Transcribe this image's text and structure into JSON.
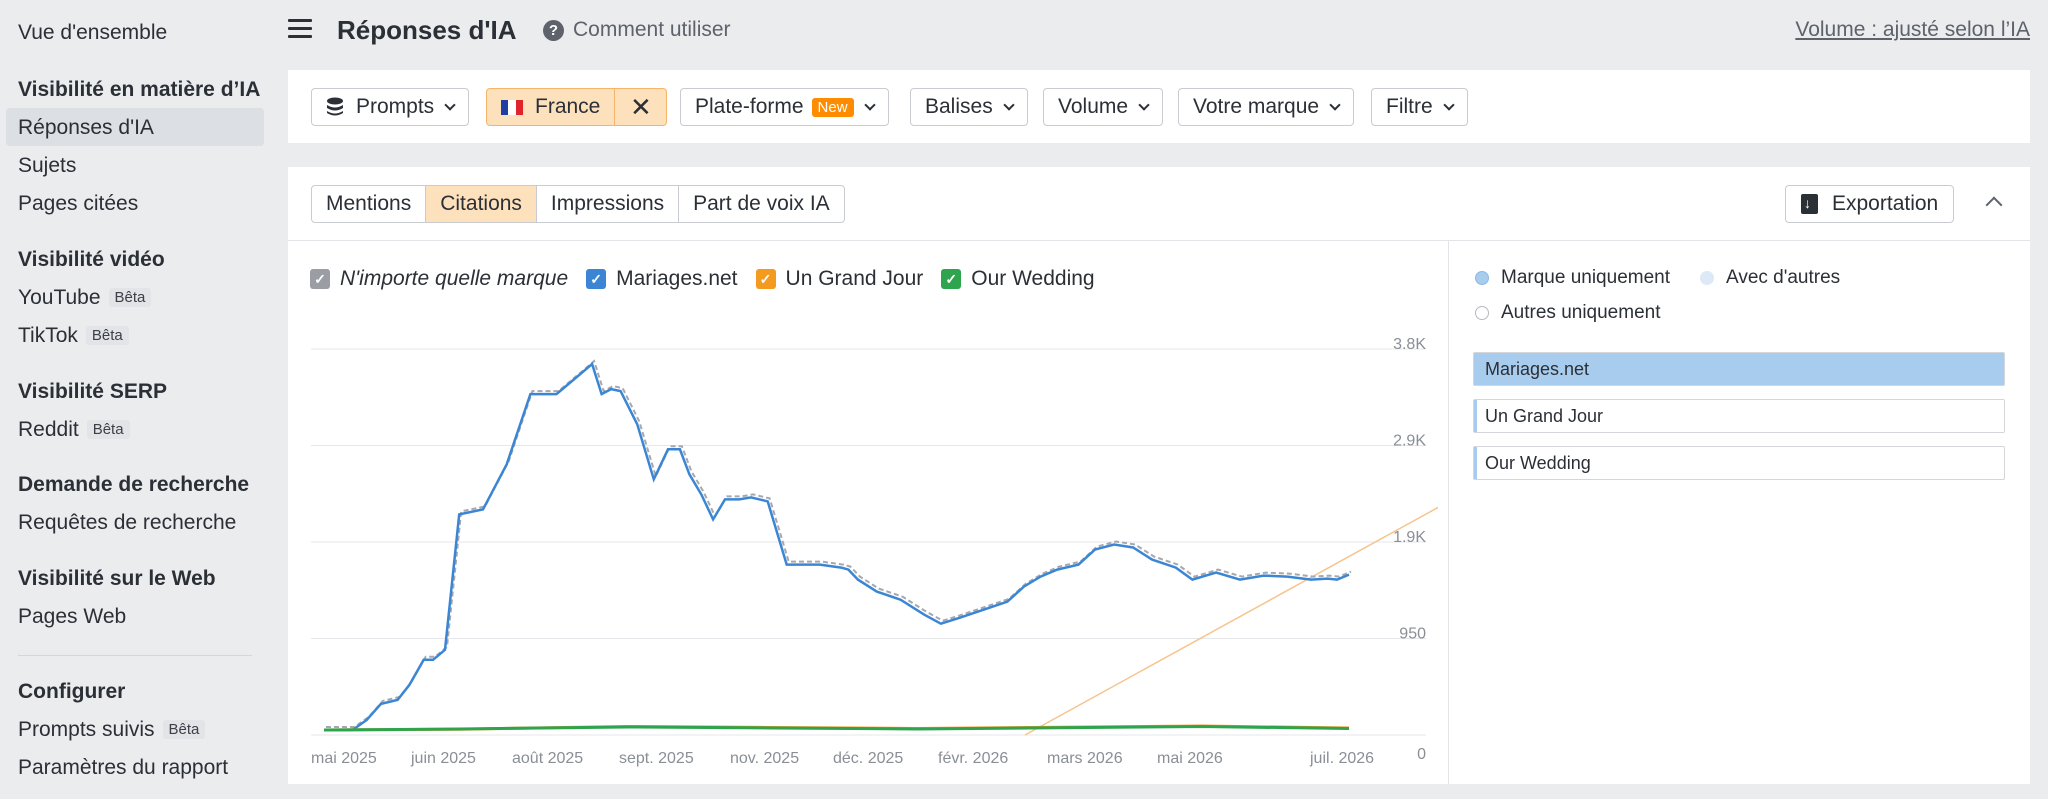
{
  "sidebar": {
    "overview": "Vue d'ensemble",
    "section_ai": "Visibilité en matière d’IA",
    "ai_items": [
      "Réponses d'IA",
      "Sujets",
      "Pages citées"
    ],
    "section_video": "Visibilité vidéo",
    "video_items": [
      {
        "label": "YouTube",
        "badge": "Bêta"
      },
      {
        "label": "TikTok",
        "badge": "Bêta"
      }
    ],
    "section_serp": "Visibilité SERP",
    "serp_items": [
      {
        "label": "Reddit",
        "badge": "Bêta"
      }
    ],
    "section_demand": "Demande de recherche",
    "demand_items": [
      "Requêtes de recherche"
    ],
    "section_web": "Visibilité sur le Web",
    "web_items": [
      "Pages Web"
    ],
    "section_config": "Configurer",
    "config_items": [
      {
        "label": "Prompts suivis",
        "badge": "Bêta"
      },
      {
        "label": "Paramètres du rapport"
      }
    ]
  },
  "header": {
    "title": "Réponses d'IA",
    "help": "Comment utiliser",
    "volume_link": "Volume : ajusté selon l’IA"
  },
  "filters": {
    "prompts": "Prompts",
    "country": "France",
    "platform": "Plate-forme",
    "platform_badge": "New",
    "tags": "Balises",
    "volume": "Volume",
    "brand": "Votre marque",
    "filter": "Filtre"
  },
  "tabs": [
    "Mentions",
    "Citations",
    "Impressions",
    "Part de voix IA"
  ],
  "active_tab": "Citations",
  "export_label": "Exportation",
  "legend": [
    {
      "label": "N'importe quelle marque",
      "color": "#9a9da3",
      "checked": true
    },
    {
      "label": "Mariages.net",
      "color": "#3a86d4",
      "checked": true
    },
    {
      "label": "Un Grand Jour",
      "color": "#f39a1f",
      "checked": true
    },
    {
      "label": "Our Wedding",
      "color": "#2ea44f",
      "checked": true
    }
  ],
  "right_panel": {
    "options": [
      "Marque uniquement",
      "Avec d'autres",
      "Autres uniquement"
    ],
    "bars": [
      {
        "label": "Mariages.net",
        "fill": 1.0
      },
      {
        "label": "Un Grand Jour",
        "fill": 0.0
      },
      {
        "label": "Our Wedding",
        "fill": 0.0
      }
    ]
  },
  "chart_data": {
    "type": "line",
    "x_ticks": [
      "mai 2025",
      "juin 2025",
      "août 2025",
      "sept. 2025",
      "nov. 2025",
      "déc. 2025",
      "févr. 2026",
      "mars 2026",
      "mai 2026",
      "juil. 2026"
    ],
    "y_ticks": [
      "3.8K",
      "2.9K",
      "1.9K",
      "950",
      "0"
    ],
    "ylim": [
      0,
      3800
    ],
    "series": [
      {
        "name": "Mariages.net",
        "color": "#3a86d4",
        "x": [
          "2025-04-26",
          "2025-05-08",
          "2025-05-14",
          "2025-05-20",
          "2025-05-27",
          "2025-06-01",
          "2025-06-07",
          "2025-06-11",
          "2025-06-16",
          "2025-06-22",
          "2025-07-02",
          "2025-07-12",
          "2025-07-22",
          "2025-08-02",
          "2025-08-12",
          "2025-08-17",
          "2025-08-21",
          "2025-08-25",
          "2025-08-29",
          "2025-09-05",
          "2025-09-12",
          "2025-09-18",
          "2025-09-23",
          "2025-09-27",
          "2025-10-02",
          "2025-10-07",
          "2025-10-12",
          "2025-10-18",
          "2025-10-23",
          "2025-10-30",
          "2025-11-07",
          "2025-11-21",
          "2025-11-30",
          "2025-12-03",
          "2025-12-07",
          "2025-12-15",
          "2025-12-25",
          "2026-01-04",
          "2026-01-11",
          "2026-01-19",
          "2026-01-29",
          "2026-02-08",
          "2026-02-15",
          "2026-02-22",
          "2026-03-01",
          "2026-03-10",
          "2026-03-17",
          "2026-03-25",
          "2026-04-02",
          "2026-04-10",
          "2026-04-20",
          "2026-04-27",
          "2026-05-07",
          "2026-05-17",
          "2026-05-27",
          "2026-06-06",
          "2026-06-16",
          "2026-06-23",
          "2026-06-27",
          "2026-07-02"
        ],
        "values": [
          0,
          0,
          100,
          260,
          300,
          450,
          700,
          700,
          800,
          2150,
          2200,
          2650,
          3350,
          3350,
          3550,
          3650,
          3350,
          3400,
          3380,
          3050,
          2500,
          2800,
          2800,
          2550,
          2350,
          2100,
          2300,
          2300,
          2320,
          2280,
          1650,
          1650,
          1620,
          1600,
          1500,
          1380,
          1300,
          1150,
          1060,
          1120,
          1200,
          1280,
          1430,
          1530,
          1600,
          1650,
          1800,
          1850,
          1820,
          1700,
          1620,
          1500,
          1570,
          1500,
          1540,
          1530,
          1500,
          1510,
          1500,
          1550
        ]
      },
      {
        "name": "Un Grand Jour",
        "color": "#f39a1f",
        "x": [
          "2025-04-26",
          "2025-06-22",
          "2025-09-01",
          "2025-11-01",
          "2026-01-01",
          "2026-05-01",
          "2026-07-02"
        ],
        "values": [
          0,
          8,
          35,
          25,
          15,
          40,
          20
        ]
      },
      {
        "name": "Our Wedding",
        "color": "#2ea44f",
        "x": [
          "2025-04-26",
          "2025-06-22",
          "2025-09-01",
          "2025-11-01",
          "2026-01-01",
          "2026-05-01",
          "2026-07-02"
        ],
        "values": [
          0,
          10,
          30,
          20,
          10,
          35,
          15
        ]
      }
    ],
    "grid": true
  }
}
